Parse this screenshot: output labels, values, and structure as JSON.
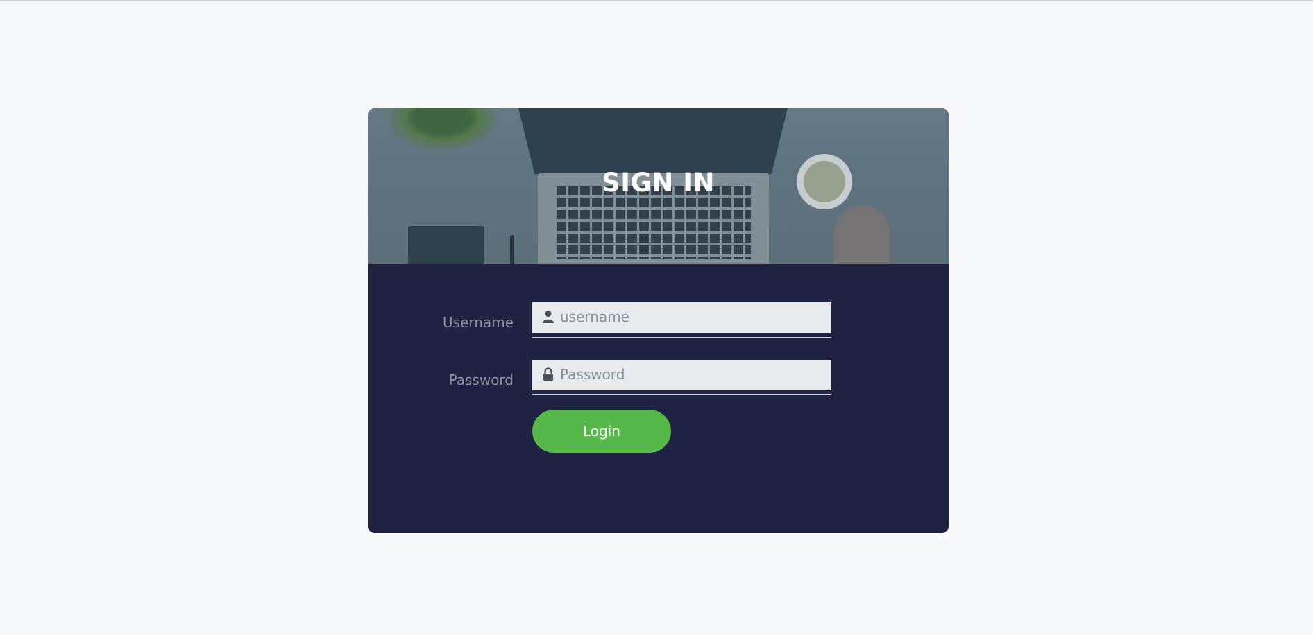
{
  "page": {
    "background": "#f7f8fa"
  },
  "card": {
    "background": "#1f2241",
    "hero_title": "SIGN IN"
  },
  "form": {
    "username": {
      "label": "Username",
      "placeholder": "username",
      "value": "",
      "icon": "user-icon"
    },
    "password": {
      "label": "Password",
      "placeholder": "Password",
      "value": "",
      "icon": "lock-icon"
    },
    "login_button": {
      "label": "Login",
      "color": "#56b849"
    }
  }
}
